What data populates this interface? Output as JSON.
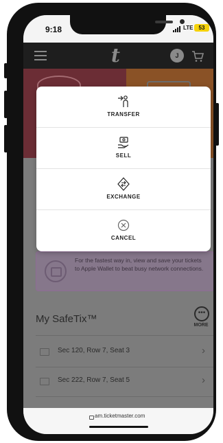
{
  "status_bar": {
    "time": "9:18",
    "network": "LTE",
    "battery": "53"
  },
  "header": {
    "logo": "t",
    "avatar_initial": "J"
  },
  "modal": {
    "actions": [
      {
        "label": "TRANSFER",
        "icon": "transfer-icon"
      },
      {
        "label": "SELL",
        "icon": "sell-icon"
      },
      {
        "label": "EXCHANGE",
        "icon": "exchange-icon"
      },
      {
        "label": "CANCEL",
        "icon": "cancel-icon"
      }
    ]
  },
  "wallet_promo": {
    "text": "For the fastest way in, view and save your tickets to Apple Wallet to beat busy network connections."
  },
  "safetix": {
    "title": "My SafeTix™",
    "more_label": "MORE",
    "tickets": [
      {
        "label": "Sec 120, Row 7, Seat 3"
      },
      {
        "label": "Sec 222, Row 7, Seat 5"
      }
    ]
  },
  "browser": {
    "url": "am.ticketmaster.com"
  },
  "colors": {
    "modal_bg": "#ffffff",
    "header_bg": "#1e1e1e",
    "battery": "#f5d20a",
    "overlay_gray": "#7a7a7a",
    "wallet_border": "#8f6b96"
  }
}
